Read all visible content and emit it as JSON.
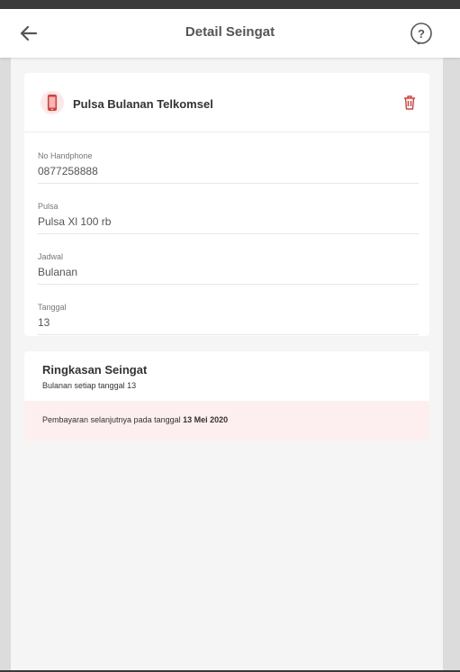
{
  "header": {
    "title": "Detail Seingat",
    "back_icon": "arrow-left-icon",
    "help_icon": "question-circle-icon"
  },
  "reminder": {
    "title": "Pulsa Bulanan Telkomsel",
    "icon": "smartphone-icon",
    "delete_icon": "trash-icon",
    "accent": "#e53935",
    "fields": [
      {
        "label": "No Handphone",
        "value": "0877258888"
      },
      {
        "label": "Pulsa",
        "value": "Pulsa Xl 100 rb"
      },
      {
        "label": "Jadwal",
        "value": "Bulanan"
      },
      {
        "label": "Tanggal",
        "value": "13"
      }
    ]
  },
  "summary": {
    "title": "Ringkasan Seingat",
    "subtitle": "Bulanan setiap tanggal 13",
    "next_payment_text": "Pembayaran selanjutnya pada tanggal",
    "next_payment_date": "13 Mei 2020",
    "note_bg": "#fdeeef"
  }
}
